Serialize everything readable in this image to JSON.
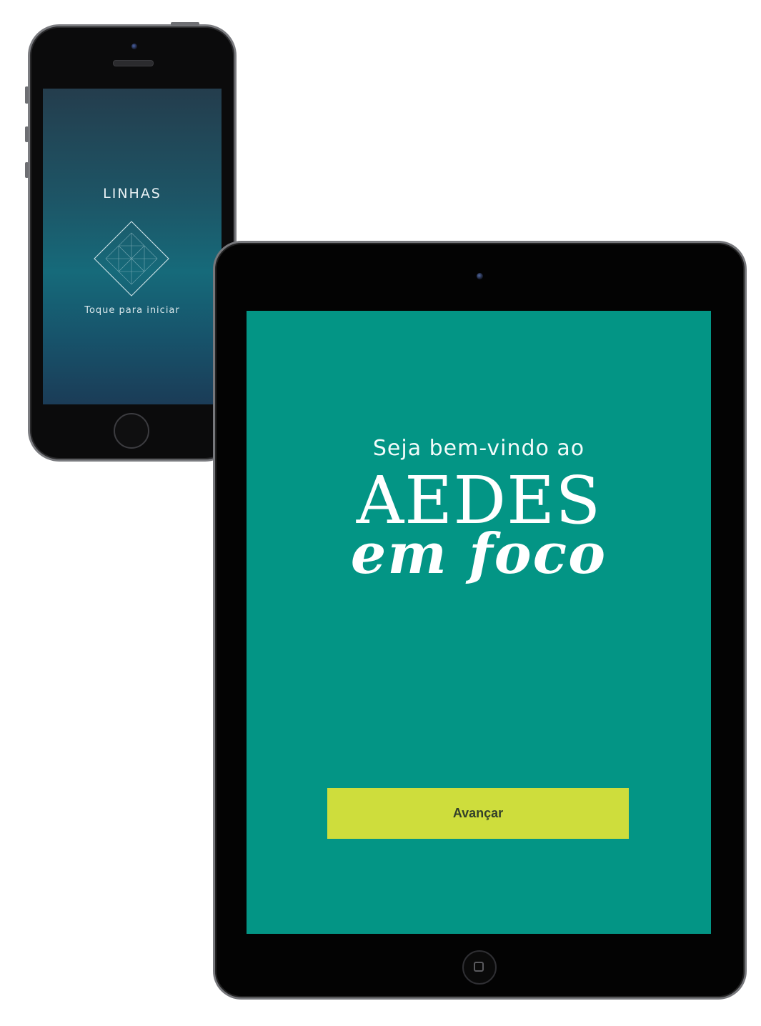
{
  "phone": {
    "app_title": "LINHAS",
    "tap_prompt": "Toque para iniciar",
    "logo_icon": "diamond-grid-icon"
  },
  "tablet": {
    "welcome": "Seja bem-vindo ao",
    "brand_main": "AEDES",
    "brand_script": "em foco",
    "advance_label": "Avançar",
    "screen_color": "#039585",
    "button_color": "#cedd3c"
  }
}
